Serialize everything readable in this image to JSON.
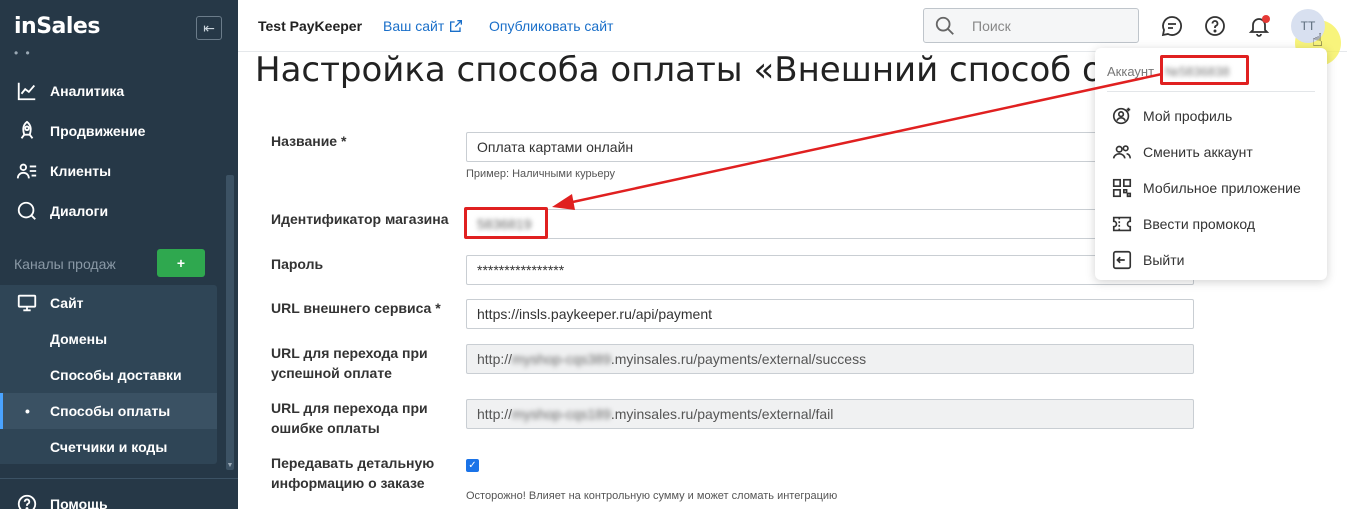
{
  "sidebar": {
    "logo": "inSales",
    "nav": [
      {
        "label": "Аналитика",
        "icon": "chart-line-icon"
      },
      {
        "label": "Продвижение",
        "icon": "rocket-icon"
      },
      {
        "label": "Клиенты",
        "icon": "users-list-icon"
      },
      {
        "label": "Диалоги",
        "icon": "chat-bubble-icon"
      }
    ],
    "channels_label": "Каналы продаж",
    "add_channel": "+",
    "site": {
      "label": "Сайт",
      "icon": "monitor-icon"
    },
    "sub_items": [
      "Домены",
      "Способы доставки",
      "Способы оплаты",
      "Счетчики и коды"
    ],
    "active_sub": "Способы оплаты",
    "help": "Помощь"
  },
  "topbar": {
    "shop_name": "Test PayKeeper",
    "your_site": "Ваш сайт",
    "publish": "Опубликовать сайт",
    "search_placeholder": "Поиск",
    "avatar_initials": "TT"
  },
  "page": {
    "title": "Настройка способа оплаты «Внешний способ опла"
  },
  "form": {
    "name_label": "Название *",
    "name_value": "Оплата картами онлайн",
    "name_hint": "Пример: Наличными курьеру",
    "shop_id_label": "Идентификатор магазина",
    "shop_id_value": "5836819",
    "password_label": "Пароль",
    "password_value": "****************",
    "url_label": "URL внешнего сервиса *",
    "url_value": "https://insls.paykeeper.ru/api/payment",
    "success_label": "URL для перехода при успешной оплате",
    "success_prefix": "http://",
    "success_blur": "myshop-cqs389",
    "success_suffix": ".myinsales.ru/payments/external/success",
    "fail_label": "URL для перехода при ошибке оплаты",
    "fail_prefix": "http://",
    "fail_blur": "myshop-cqs189",
    "fail_suffix": ".myinsales.ru/payments/external/fail",
    "detail_label": "Передавать детальную информацию о заказе",
    "detail_checked": true,
    "detail_hint": "Осторожно! Влияет на контрольную сумму и может сломать интеграцию"
  },
  "dropdown": {
    "account_label": "Аккаунт",
    "account_id": "№5836838",
    "items": [
      {
        "label": "Мой профиль",
        "icon": "profile-icon"
      },
      {
        "label": "Сменить аккаунт",
        "icon": "switch-account-icon"
      },
      {
        "label": "Мобильное приложение",
        "icon": "qr-code-icon"
      },
      {
        "label": "Ввести промокод",
        "icon": "ticket-icon"
      },
      {
        "label": "Выйти",
        "icon": "logout-icon"
      }
    ]
  },
  "colors": {
    "sidebar_bg": "#263847",
    "accent_link": "#1a6fc9",
    "annotation_red": "#e02020",
    "add_button": "#2fa84f"
  }
}
